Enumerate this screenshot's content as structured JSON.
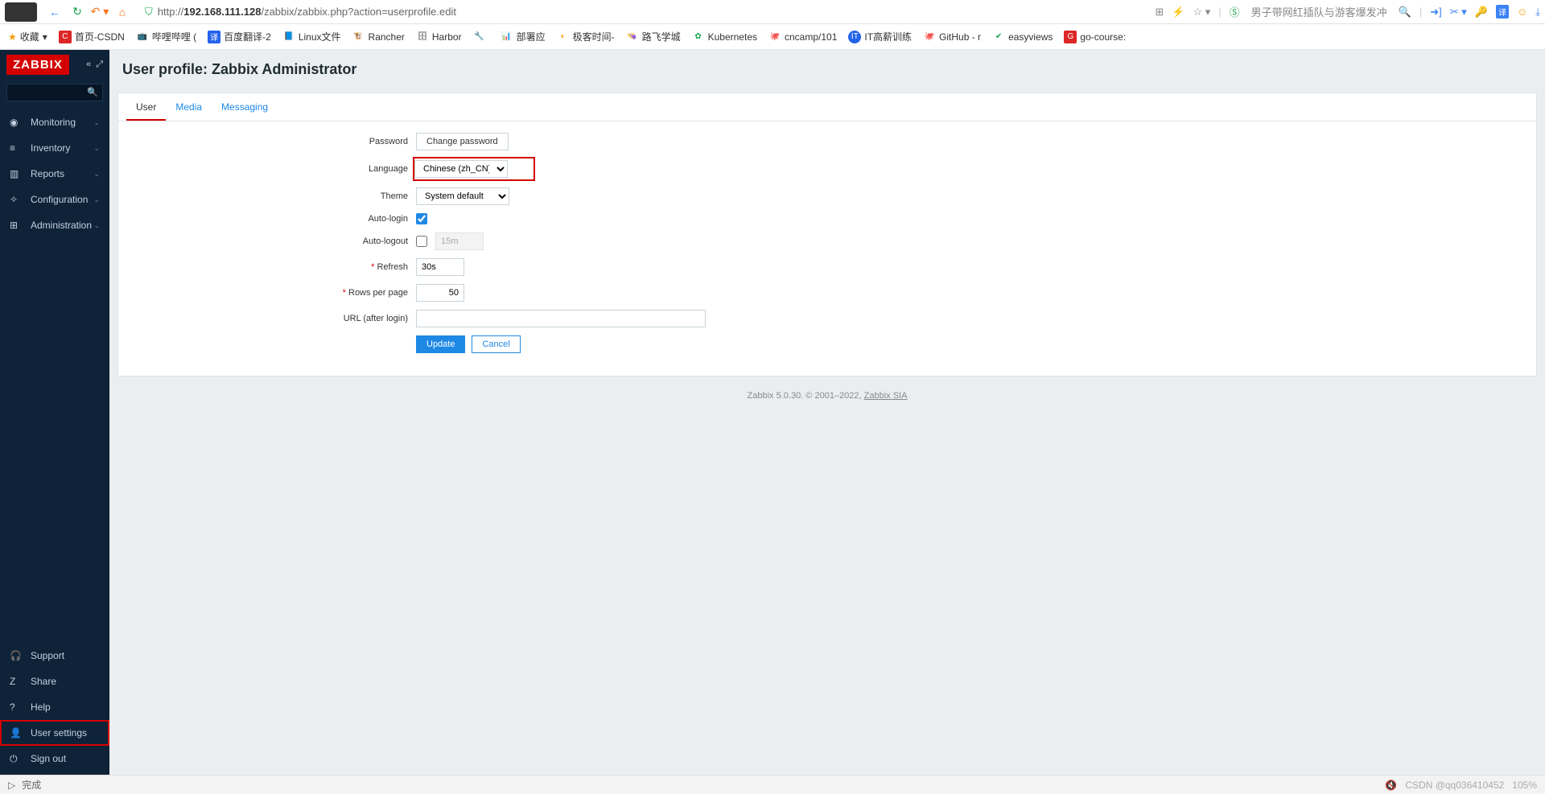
{
  "browser": {
    "url_prefix": "http://",
    "url_host": "192.168.111.128",
    "url_path": "/zabbix/zabbix.php?action=userprofile.edit",
    "search_hint": "男子带网红插队与游客爆发冲"
  },
  "bookmarks": {
    "fav": "收藏",
    "items": [
      "首页-CSDN",
      "哔哩哔哩 (",
      "百度翻译-2",
      "Linux文件",
      "Rancher",
      "Harbor",
      "",
      "部署应",
      "极客时间-",
      "路飞学城",
      "Kubernetes",
      "cncamp/101",
      "IT高薪训练",
      "GitHub - r",
      "easyviews",
      "go-course:"
    ]
  },
  "sidebar": {
    "logo": "ZABBIX",
    "nav": [
      {
        "icon": "◉",
        "label": "Monitoring"
      },
      {
        "icon": "≡",
        "label": "Inventory"
      },
      {
        "icon": "▥",
        "label": "Reports"
      },
      {
        "icon": "✧",
        "label": "Configuration"
      },
      {
        "icon": "⊞",
        "label": "Administration"
      }
    ],
    "bottom": [
      {
        "icon": "🎧",
        "label": "Support"
      },
      {
        "icon": "Z",
        "label": "Share"
      },
      {
        "icon": "?",
        "label": "Help"
      },
      {
        "icon": "👤",
        "label": "User settings"
      },
      {
        "icon": "⏻",
        "label": "Sign out"
      }
    ]
  },
  "page": {
    "title": "User profile: Zabbix Administrator",
    "tabs": [
      "User",
      "Media",
      "Messaging"
    ],
    "labels": {
      "password": "Password",
      "change_password": "Change password",
      "language": "Language",
      "theme": "Theme",
      "auto_login": "Auto-login",
      "auto_logout": "Auto-logout",
      "refresh": "Refresh",
      "rows": "Rows per page",
      "url": "URL (after login)"
    },
    "values": {
      "language": "Chinese (zh_CN)",
      "theme": "System default",
      "auto_login": true,
      "auto_logout_enabled": false,
      "auto_logout": "15m",
      "refresh": "30s",
      "rows": "50",
      "url": ""
    },
    "actions": {
      "update": "Update",
      "cancel": "Cancel"
    }
  },
  "footer": {
    "text": "Zabbix 5.0.30. © 2001–2022, ",
    "link": "Zabbix SIA"
  },
  "status": {
    "left": "完成",
    "right_watermark": "CSDN @qq036410452",
    "right_zoom": "105%"
  }
}
